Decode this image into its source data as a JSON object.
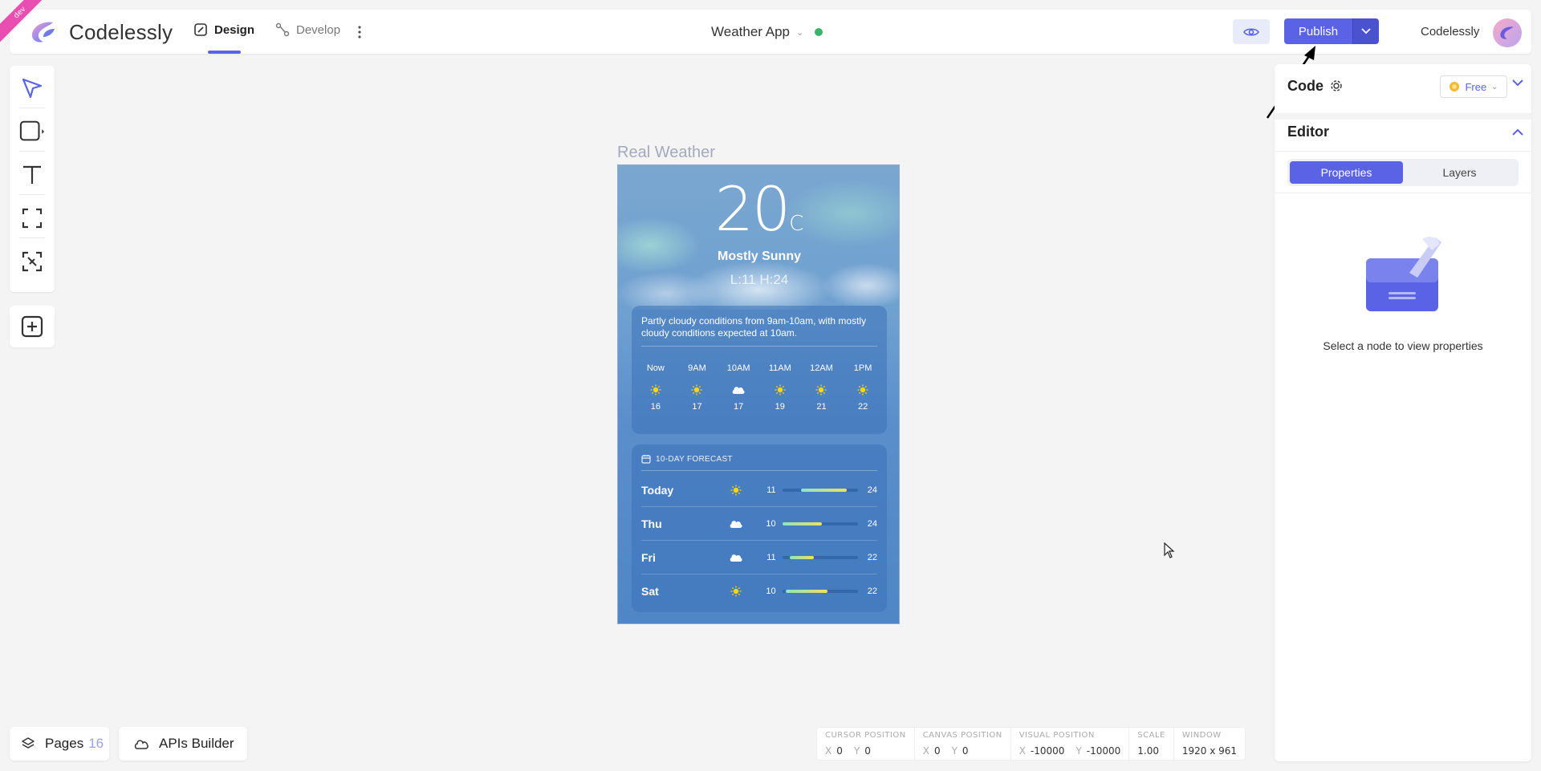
{
  "header": {
    "ribbon": "dev",
    "brand": "Codelessly",
    "tabs": [
      {
        "label": "Design",
        "active": true
      },
      {
        "label": "Develop",
        "active": false
      }
    ],
    "project_name": "Weather App",
    "status_color": "#36b66a",
    "publish_label": "Publish",
    "user_name": "Codelessly"
  },
  "toolbar": {
    "tools": [
      "select-tool",
      "shape-tool",
      "text-tool",
      "frame-tool",
      "magic-select-tool"
    ],
    "add": "add-icon"
  },
  "canvas": {
    "frame_title": "Real Weather",
    "weather": {
      "temp": "20",
      "unit": "C",
      "condition": "Mostly Sunny",
      "lohi": "L:11 H:24",
      "description": "Partly cloudy conditions from 9am-10am, with mostly cloudy conditions expected at 10am.",
      "hours": [
        {
          "label": "Now",
          "icon": "sun",
          "temp": "16"
        },
        {
          "label": "9AM",
          "icon": "sun",
          "temp": "17"
        },
        {
          "label": "10AM",
          "icon": "cloud",
          "temp": "17"
        },
        {
          "label": "11AM",
          "icon": "sun",
          "temp": "19"
        },
        {
          "label": "12AM",
          "icon": "sun",
          "temp": "21"
        },
        {
          "label": "1PM",
          "icon": "sun",
          "temp": "22"
        }
      ],
      "forecast_title": "10-DAY FORECAST",
      "days": [
        {
          "day": "Today",
          "icon": "sun",
          "lo": "11",
          "hi": "24",
          "range": [
            0.25,
            0.85
          ]
        },
        {
          "day": "Thu",
          "icon": "cloud",
          "lo": "10",
          "hi": "24",
          "range": [
            0.0,
            0.52
          ]
        },
        {
          "day": "Fri",
          "icon": "cloud",
          "lo": "11",
          "hi": "22",
          "range": [
            0.1,
            0.42
          ]
        },
        {
          "day": "Sat",
          "icon": "sun",
          "lo": "10",
          "hi": "22",
          "range": [
            0.05,
            0.6
          ]
        }
      ]
    }
  },
  "panel": {
    "code_label": "Code",
    "plan_label": "Free",
    "editor_title": "Editor",
    "tabs": [
      "Properties",
      "Layers"
    ],
    "empty_message": "Select a node to view properties"
  },
  "bottom": {
    "pages_label": "Pages",
    "pages_count": "16",
    "apis_label": "APIs Builder"
  },
  "statusbar": {
    "cursor": {
      "title": "CURSOR POSITION",
      "x": "0",
      "y": "0"
    },
    "canvas": {
      "title": "CANVAS POSITION",
      "x": "0",
      "y": "0"
    },
    "visual": {
      "title": "VISUAL POSITION",
      "x": "-10000",
      "y": "-10000"
    },
    "scale": {
      "title": "SCALE",
      "value": "1.00"
    },
    "window": {
      "title": "WINDOW",
      "value": "1920 x 961"
    }
  },
  "colors": {
    "accent": "#5a63e6",
    "ribbon": "#e94fb0"
  }
}
